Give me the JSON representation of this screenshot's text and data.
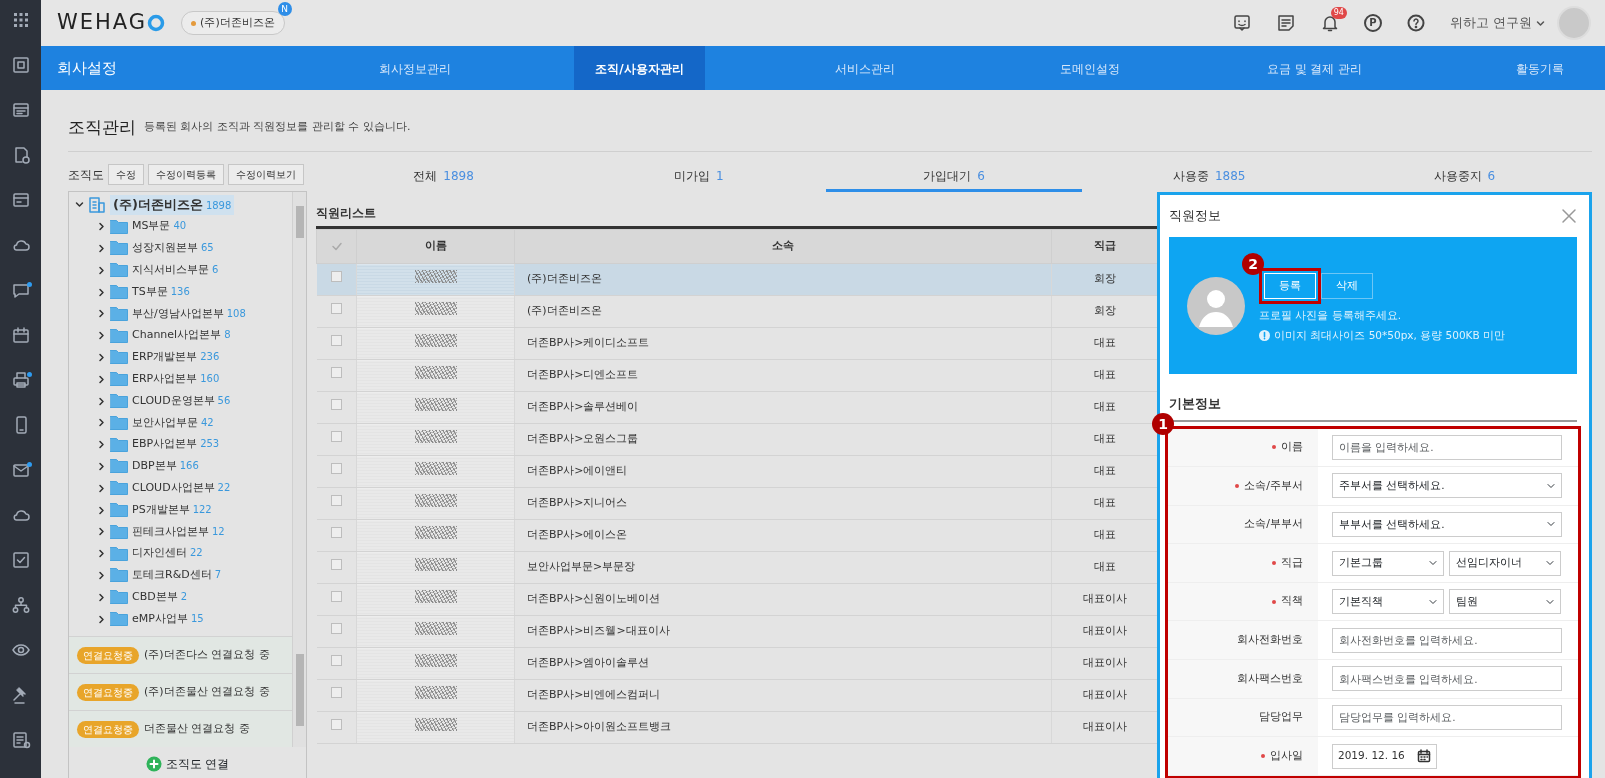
{
  "sidebar": {
    "items": [
      {
        "kind": "grid",
        "badge": false
      },
      {
        "kind": "box",
        "badge": false
      },
      {
        "kind": "window",
        "badge": false
      },
      {
        "kind": "document",
        "badge": false
      },
      {
        "kind": "card",
        "badge": false
      },
      {
        "kind": "cloud",
        "badge": false
      },
      {
        "kind": "chat",
        "badge": true
      },
      {
        "kind": "calendar",
        "badge": false
      },
      {
        "kind": "printer",
        "badge": true
      },
      {
        "kind": "phone",
        "badge": false
      },
      {
        "kind": "mail",
        "badge": true
      },
      {
        "kind": "cloud",
        "badge": false
      },
      {
        "kind": "check",
        "badge": false
      },
      {
        "kind": "org",
        "badge": false
      },
      {
        "kind": "eye",
        "badge": false
      },
      {
        "kind": "gavel",
        "badge": false
      },
      {
        "kind": "list",
        "badge": false
      }
    ]
  },
  "header": {
    "logo": "WEHAG",
    "company": {
      "name": "(주)더존비즈온",
      "badge": "N"
    },
    "icons": [
      {
        "kind": "chat"
      },
      {
        "kind": "note"
      },
      {
        "kind": "bell",
        "badge": "94"
      },
      {
        "kind": "point",
        "glyph": "P"
      },
      {
        "kind": "help"
      }
    ],
    "user": "위하고 연구원"
  },
  "nav": {
    "title": "회사설정",
    "items": [
      {
        "label": "회사정보관리",
        "selected": false
      },
      {
        "label": "조직/사용자관리",
        "selected": true
      },
      {
        "label": "서비스관리",
        "selected": false
      },
      {
        "label": "도메인설정",
        "selected": false
      },
      {
        "label": "요금 및 결제 관리",
        "selected": false
      },
      {
        "label": "활동기록",
        "selected": false
      }
    ]
  },
  "page": {
    "title": "조직관리",
    "description": "등록된 회사의 조직과 직원정보를 관리할 수 있습니다."
  },
  "org": {
    "label": "조직도",
    "buttons": [
      "수정",
      "수정이력등록",
      "수정이력보기"
    ],
    "root": {
      "name": "(주)더존비즈온",
      "count": "1898",
      "expanded": true,
      "selected": true,
      "children": [
        {
          "name": "MS부문",
          "count": "40"
        },
        {
          "name": "성장지원본부",
          "count": "65"
        },
        {
          "name": "지식서비스부문",
          "count": "6"
        },
        {
          "name": "TS부문",
          "count": "136"
        },
        {
          "name": "부산/영남사업본부",
          "count": "108"
        },
        {
          "name": "Channel사업본부",
          "count": "8"
        },
        {
          "name": "ERP개발본부",
          "count": "236"
        },
        {
          "name": "ERP사업본부",
          "count": "160"
        },
        {
          "name": "CLOUD운영본부",
          "count": "56"
        },
        {
          "name": "보안사업부문",
          "count": "42"
        },
        {
          "name": "EBP사업본부",
          "count": "253"
        },
        {
          "name": "DBP본부",
          "count": "166"
        },
        {
          "name": "CLOUD사업본부",
          "count": "22"
        },
        {
          "name": "PS개발본부",
          "count": "122"
        },
        {
          "name": "핀테크사업본부",
          "count": "12"
        },
        {
          "name": "디자인센터",
          "count": "22"
        },
        {
          "name": "토테크R&D센터",
          "count": "7"
        },
        {
          "name": "CBD본부",
          "count": "2"
        },
        {
          "name": "eMP사업부",
          "count": "15"
        }
      ]
    },
    "requests": [
      {
        "badge": "연결요청중",
        "text": "(주)더존다스 연결요청 중"
      },
      {
        "badge": "연결요청중",
        "text": "(주)더존물산 연결요청 중"
      },
      {
        "badge": "연결요청중",
        "text": "더존물산 연결요청 중"
      }
    ],
    "connect": "조직도 연결"
  },
  "tabs": [
    {
      "label": "전체",
      "count": "1898",
      "selected": false
    },
    {
      "label": "미가입",
      "count": "1",
      "selected": false
    },
    {
      "label": "가입대기",
      "count": "6",
      "selected": true
    },
    {
      "label": "사용중",
      "count": "1885",
      "selected": false
    },
    {
      "label": "사용중지",
      "count": "6",
      "selected": false
    }
  ],
  "employees": {
    "title": "직원리스트",
    "columns": [
      "이름",
      "소속",
      "직급"
    ],
    "rows": [
      {
        "affiliation": "(주)더존비즈온",
        "rank": "회장",
        "selected": true,
        "checked": false
      },
      {
        "affiliation": "(주)더존비즈온",
        "rank": "회장",
        "selected": false,
        "checked": false
      },
      {
        "affiliation": "더존BP사>케이디소프트",
        "rank": "대표",
        "selected": false,
        "checked": false
      },
      {
        "affiliation": "더존BP사>디엔소프트",
        "rank": "대표",
        "selected": false,
        "checked": false
      },
      {
        "affiliation": "더존BP사>솔루션베이",
        "rank": "대표",
        "selected": false,
        "checked": false
      },
      {
        "affiliation": "더존BP사>오원스그룹",
        "rank": "대표",
        "selected": false,
        "checked": false
      },
      {
        "affiliation": "더존BP사>에이앤티",
        "rank": "대표",
        "selected": false,
        "checked": false
      },
      {
        "affiliation": "더존BP사>지니어스",
        "rank": "대표",
        "selected": false,
        "checked": false
      },
      {
        "affiliation": "더존BP사>에이스온",
        "rank": "대표",
        "selected": false,
        "checked": false
      },
      {
        "affiliation": "보안사업부문>부문장",
        "rank": "대표",
        "selected": false,
        "checked": false
      },
      {
        "affiliation": "더존BP사>신원이노베이션",
        "rank": "대표이사",
        "selected": false,
        "checked": false
      },
      {
        "affiliation": "더존BP사>비즈웰>대표이사",
        "rank": "대표이사",
        "selected": false,
        "checked": false
      },
      {
        "affiliation": "더존BP사>엠아이솔루션",
        "rank": "대표이사",
        "selected": false,
        "checked": false
      },
      {
        "affiliation": "더존BP사>비엔에스컴퍼니",
        "rank": "대표이사",
        "selected": false,
        "checked": false
      },
      {
        "affiliation": "더존BP사>아이원소프트뱅크",
        "rank": "대표이사",
        "selected": false,
        "checked": false
      }
    ]
  },
  "panel": {
    "title": "직원정보",
    "buttons": [
      "등록",
      "삭제"
    ],
    "hint": "프로필 사진을 등록해주세요.",
    "note": "이미지 최대사이즈 50*50px, 용량 500KB 미만",
    "section": "기본정보",
    "fields": [
      {
        "label": "이름",
        "required": true,
        "kind": "text",
        "placeholder": "이름을 입력하세요."
      },
      {
        "label": "소속/주부서",
        "required": true,
        "kind": "select",
        "values": [
          "주부서를 선택하세요."
        ]
      },
      {
        "label": "소속/부부서",
        "required": false,
        "kind": "select",
        "values": [
          "부부서를 선택하세요."
        ]
      },
      {
        "label": "직급",
        "required": true,
        "kind": "select",
        "values": [
          "기본그룹",
          "선임디자이너"
        ]
      },
      {
        "label": "직책",
        "required": true,
        "kind": "select",
        "values": [
          "기본직책",
          "팀원"
        ]
      },
      {
        "label": "회사전화번호",
        "required": false,
        "kind": "text",
        "placeholder": "회사전화번호를 입력하세요."
      },
      {
        "label": "회사팩스번호",
        "required": false,
        "kind": "text",
        "placeholder": "회사팩스번호를 입력하세요."
      },
      {
        "label": "담당업무",
        "required": false,
        "kind": "text",
        "placeholder": "담당업무를 입력하세요."
      },
      {
        "label": "입사일",
        "required": true,
        "kind": "date",
        "value": "2019. 12. 16"
      }
    ]
  },
  "annotations": {
    "form_marker": "1",
    "button_marker": "2"
  }
}
